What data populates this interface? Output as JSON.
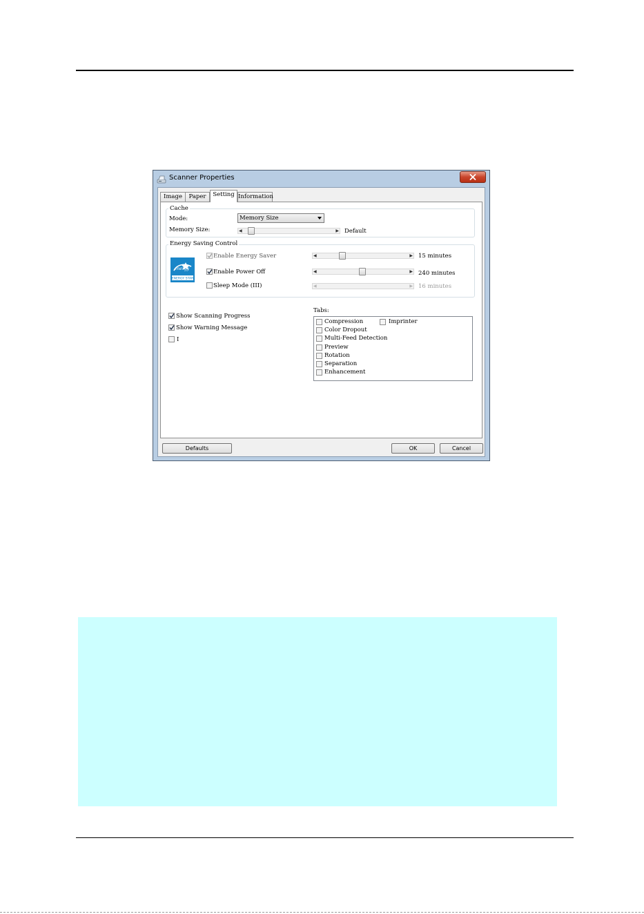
{
  "dialog": {
    "title": "Scanner Properties",
    "tabs": [
      "Image",
      "Paper",
      "Setting",
      "Information"
    ],
    "active_tab": "Setting"
  },
  "cache": {
    "group_label": "Cache",
    "mode_label": "Mode:",
    "mode_value": "Memory Size",
    "memory_size_label": "Memory Size:",
    "memory_size_value": "Default",
    "memory_slider_level": 0.08
  },
  "energy": {
    "group_label": "Energy Saving Control",
    "logo_icon": "energy-star-logo",
    "items": [
      {
        "label": "Enable Energy Saver",
        "checked": true,
        "enabled": false,
        "value": "15 minutes",
        "level": 0.27
      },
      {
        "label": "Enable Power Off",
        "checked": true,
        "enabled": true,
        "value": "240 minutes",
        "level": 0.48
      },
      {
        "label": "Sleep Mode (III)",
        "checked": false,
        "enabled": true,
        "value": "16 minutes",
        "level": null
      }
    ]
  },
  "options": [
    {
      "label": "Show Scanning Progress",
      "checked": true
    },
    {
      "label": "Show Warning Message",
      "checked": true
    },
    {
      "label": "I",
      "checked": false
    }
  ],
  "tabs_group": {
    "label": "Tabs:",
    "items": [
      {
        "label": "Compression",
        "checked": false
      },
      {
        "label": "Imprinter",
        "checked": false
      },
      {
        "label": "Color Dropout",
        "checked": false
      },
      {
        "label": "Multi-Feed Detection",
        "checked": false
      },
      {
        "label": "Preview",
        "checked": false
      },
      {
        "label": "Rotation",
        "checked": false
      },
      {
        "label": "Separation",
        "checked": false
      },
      {
        "label": "Enhancement",
        "checked": false
      }
    ]
  },
  "buttons": {
    "defaults": "Defaults",
    "ok": "OK",
    "cancel": "Cancel"
  },
  "colors": {
    "note_box": "#ccffff",
    "window_frame": "#b8cde3",
    "close_button": "#c9452c"
  }
}
